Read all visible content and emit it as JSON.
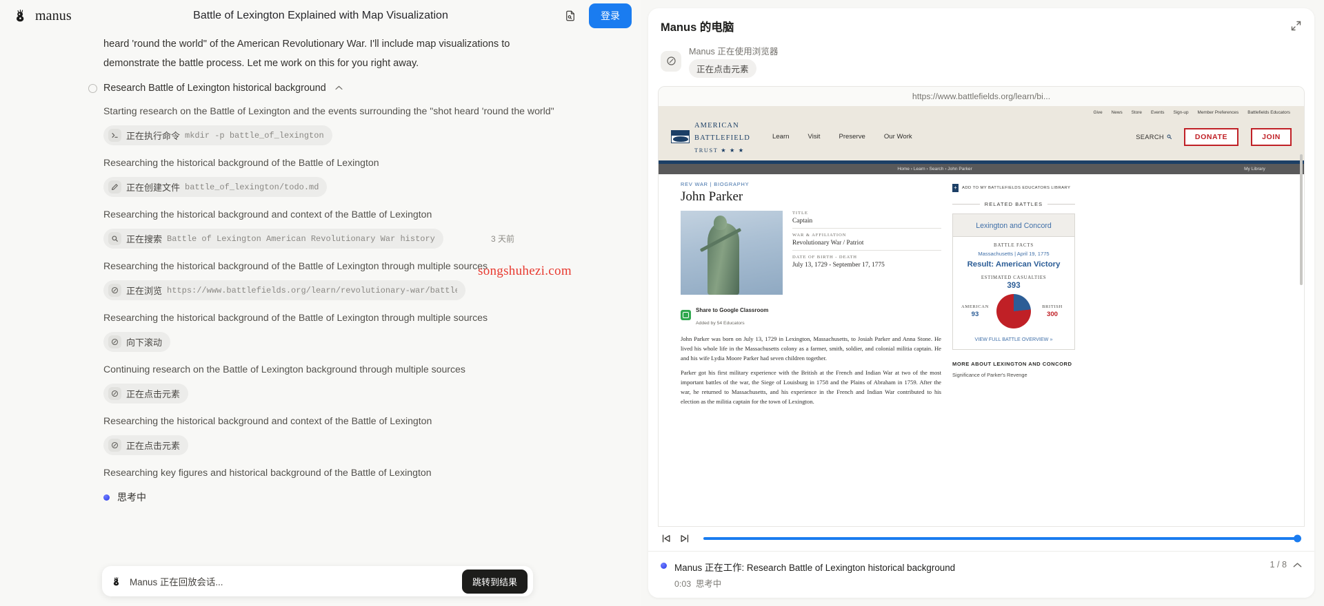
{
  "topbar": {
    "brand": "manus",
    "title": "Battle of Lexington Explained with Map Visualization",
    "share_icon": "file-search-icon",
    "login_label": "登录"
  },
  "thread": {
    "intro": "heard 'round the world\" of the American Revolutionary War. I'll include map visualizations to demonstrate the battle process. Let me work on this for you right away.",
    "step": {
      "title": "Research Battle of Lexington historical background",
      "chevron": "⌃"
    },
    "timestamp": "3 天前",
    "entries": [
      {
        "text": "Starting research on the Battle of Lexington and the events surrounding the \"shot heard 'round the world\"",
        "chip_icon": "terminal-icon",
        "chip_label": "正在执行命令",
        "chip_arg": "mkdir -p battle_of_lexington"
      },
      {
        "text": "Researching the historical background of the Battle of Lexington",
        "chip_icon": "pencil-icon",
        "chip_label": "正在创建文件",
        "chip_arg": "battle_of_lexington/todo.md"
      },
      {
        "text": "Researching the historical background and context of the Battle of Lexington",
        "chip_icon": "search-icon",
        "chip_label": "正在搜索",
        "chip_arg": "Battle of Lexington American Revolutionary War history"
      },
      {
        "text": "Researching the historical background of the Battle of Lexington through multiple sources",
        "chip_icon": "browser-icon",
        "chip_label": "正在浏览",
        "chip_arg": "https://www.battlefields.org/learn/revolutionary-war/battles/lexington-and-concord"
      },
      {
        "text": "Researching the historical background of the Battle of Lexington through multiple sources",
        "chip_icon": "browser-icon",
        "chip_label": "向下滚动",
        "chip_arg": ""
      },
      {
        "text": "Continuing research on the Battle of Lexington background through multiple sources",
        "chip_icon": "browser-icon",
        "chip_label": "正在点击元素",
        "chip_arg": ""
      },
      {
        "text": "Researching the historical background and context of the Battle of Lexington",
        "chip_icon": "browser-icon",
        "chip_label": "正在点击元素",
        "chip_arg": ""
      }
    ],
    "tail_text": "Researching key figures and historical background of the Battle of Lexington",
    "thinking_label": "思考中"
  },
  "watermark": "songshuhezi.com",
  "playback": {
    "text": "Manus 正在回放会话...",
    "button": "跳转到结果"
  },
  "computer": {
    "title": "Manus 的电脑",
    "collapse_icon": "collapse-icon",
    "sub_icon": "browser-icon",
    "sub_line1": "Manus 正在使用浏览器",
    "sub_chip": "正在点击元素",
    "url": "https://www.battlefields.org/learn/bi...",
    "media": {
      "skip_start_icon": "skip-start-icon",
      "step_forward_icon": "step-forward-icon",
      "progress_percent": 100
    },
    "footer": {
      "line1": "Manus 正在工作: Research Battle of Lexington historical background",
      "line2_time": "0:03",
      "line2_status": "思考中",
      "counter": "1 / 8",
      "chevron_icon": "chevron-up-icon"
    }
  },
  "site": {
    "utility_nav": [
      "Give",
      "News",
      "Store",
      "Events",
      "Sign-up",
      "Member Preferences",
      "Battlefields Educators"
    ],
    "logo": {
      "line1": "AMERICAN",
      "line2": "BATTLEFIELD",
      "line3": "TRUST ★ ★ ★"
    },
    "main_nav": [
      "Learn",
      "Visit",
      "Preserve",
      "Our Work"
    ],
    "search_label": "SEARCH",
    "donate_label": "DONATE",
    "join_label": "JOIN",
    "breadcrumb": "Home › Learn › Search › John Parker",
    "breadcrumb_right": "My Library",
    "kicker": "REV WAR  |  BIOGRAPHY",
    "heading": "John Parker",
    "facts": [
      {
        "key": "TITLE",
        "value": "Captain"
      },
      {
        "key": "WAR & AFFILIATION",
        "value": "Revolutionary War / Patriot"
      },
      {
        "key": "DATE OF BIRTH - DEATH",
        "value": "July 13, 1729 - September 17, 1775"
      }
    ],
    "classroom": {
      "title": "Share to Google Classroom",
      "sub": "Added by 54 Educators"
    },
    "paragraphs": [
      "John Parker was born on July 13, 1729 in Lexington, Massachusetts, to Josiah Parker and Anna Stone. He lived his whole life in the Massachusetts colony as a farmer, smith, soldier, and colonial militia captain. He and his wife Lydia Moore Parker had seven children together.",
      "Parker got his first military experience with the British at the French and Indian War at two of the most important battles of the war, the Siege of Louisburg in 1758 and the Plains of Abraham in 1759. After the war, he returned to Massachusetts, and his experience in the French and Indian War contributed to his election as the militia captain for the town of Lexington."
    ],
    "add_library": "ADD TO MY BATTLEFIELDS EDUCATORS LIBRARY",
    "related_header": "RELATED BATTLES",
    "related_card": {
      "title": "Lexington and Concord",
      "facts_label": "BATTLE FACTS",
      "meta": "Massachusetts | April 19, 1775",
      "result": "Result: American Victory",
      "casualties_label": "ESTIMATED CASUALTIES",
      "casualties_total": "393",
      "american_label": "AMERICAN",
      "american_value": "93",
      "british_label": "BRITISH",
      "british_value": "300",
      "view_full": "VIEW FULL BATTLE OVERVIEW »"
    },
    "more_about_title": "MORE ABOUT LEXINGTON AND CONCORD",
    "more_about_link": "Significance of Parker's Revenge"
  },
  "colors": {
    "accent_blue": "#1a7cf0",
    "site_navy": "#1c3f66",
    "site_red": "#c02026",
    "thinking": "#2a3ae8"
  }
}
